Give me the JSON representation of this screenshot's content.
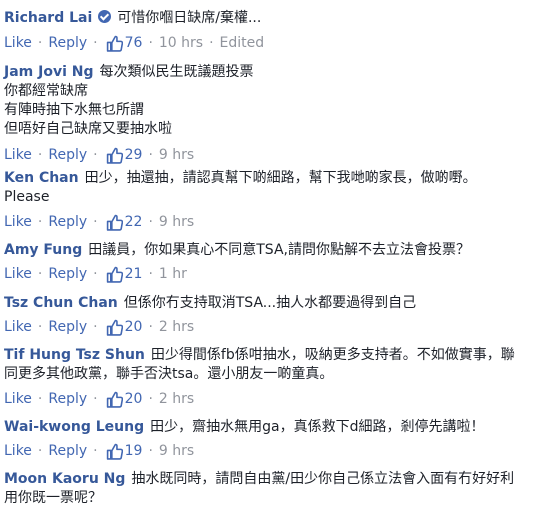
{
  "actions": {
    "like": "Like",
    "reply": "Reply",
    "sep": "·"
  },
  "comments": [
    {
      "author": "Richard Lai",
      "verified": true,
      "lines": [
        "可惜你嗰日缺席/棄權..."
      ],
      "likes": "76",
      "time": "10 hrs",
      "edited": "Edited"
    },
    {
      "author": "Jam Jovi Ng",
      "lines": [
        "每次類似民生既議題投票",
        "你都經常缺席",
        "有陣時抽下水無乜所謂",
        "但唔好自己缺席又要抽水啦"
      ],
      "likes": "29",
      "time": "9 hrs"
    },
    {
      "author": "Ken Chan",
      "lines": [
        "田少，抽還抽，請認真幫下啲細路，幫下我哋啲家長，做啲嘢。",
        "Please"
      ],
      "likes": "22",
      "time": "9 hrs"
    },
    {
      "author": "Amy Fung",
      "lines": [
        "田議員，你如果真心不同意TSA,請問你點解不去立法會投票？"
      ],
      "likes": "21",
      "time": "1 hr"
    },
    {
      "author": "Tsz Chun Chan",
      "lines": [
        "但係你冇支持取消TSA...抽人水都要過得到自己"
      ],
      "likes": "20",
      "time": "2 hrs"
    },
    {
      "author": "Tif Hung Tsz Shun",
      "lines": [
        "田少得間係fb係咁抽水，吸納更多支持者。不如做實事，聯",
        "同更多其他政黨，聯手否決tsa。還小朋友一啲童真。"
      ],
      "likes": "20",
      "time": "2 hrs"
    },
    {
      "author": "Wai-kwong Leung",
      "lines": [
        "田少，齋抽水無用ga，真係救下d細路，剎停先講啦！"
      ],
      "likes": "19",
      "time": "9 hrs"
    },
    {
      "author": "Moon Kaoru Ng",
      "lines": [
        "抽水既同時，請問自由黨/田少你自己係立法會入面有冇好好利",
        "用你既一票呢？"
      ],
      "likes": "",
      "time": ""
    }
  ]
}
